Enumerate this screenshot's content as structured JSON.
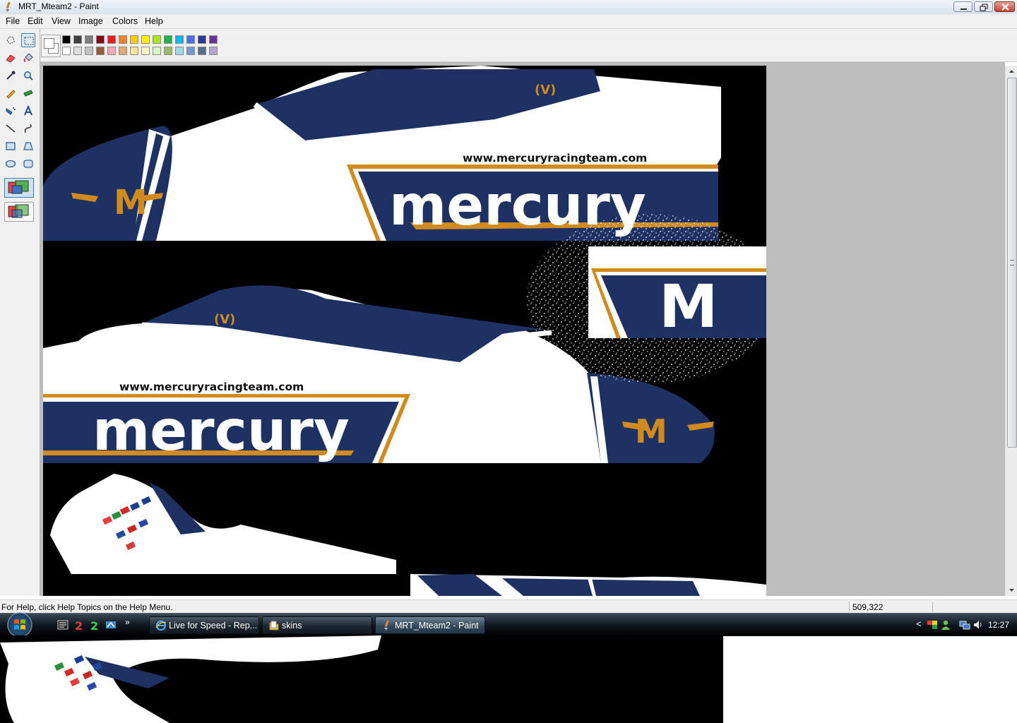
{
  "window": {
    "title": "MRT_Mteam2 - Paint"
  },
  "menu": {
    "items": [
      "File",
      "Edit",
      "View",
      "Image",
      "Colors",
      "Help"
    ]
  },
  "palette": {
    "top_row": [
      "#000000",
      "#404040",
      "#7f7f7f",
      "#880015",
      "#ed1c24",
      "#ff7f27",
      "#ffc90e",
      "#fff200",
      "#a8e61d",
      "#22b14c",
      "#00b7ef",
      "#4d6df3",
      "#2f3699",
      "#6f3198"
    ],
    "bottom_row": [
      "#ffffff",
      "#dcdcdc",
      "#c3c3c3",
      "#9c5a3c",
      "#ffa3b1",
      "#e5aa7a",
      "#f5e49c",
      "#fff9bd",
      "#d3f9bc",
      "#9dbb61",
      "#99d9ea",
      "#709ad1",
      "#546d8e",
      "#b5a5d5"
    ]
  },
  "canvas": {
    "url_text": "www.mercuryracingteam.com",
    "brand_text": "mercury",
    "badge_text": "(V)",
    "logo_letter": "M",
    "colors": {
      "navy": "#1e3163",
      "gold": "#d08a1e",
      "white": "#ffffff",
      "black": "#000000"
    }
  },
  "status": {
    "help": "For Help, click Help Topics on the Help Menu.",
    "coords": "509,322"
  },
  "taskbar": {
    "buttons": [
      {
        "label": "Live for Speed - Rep...",
        "icon": "ie-icon"
      },
      {
        "label": "skins",
        "icon": "folder-icon"
      },
      {
        "label": "MRT_Mteam2 - Paint",
        "icon": "paint-icon"
      }
    ],
    "clock": "12:27"
  }
}
